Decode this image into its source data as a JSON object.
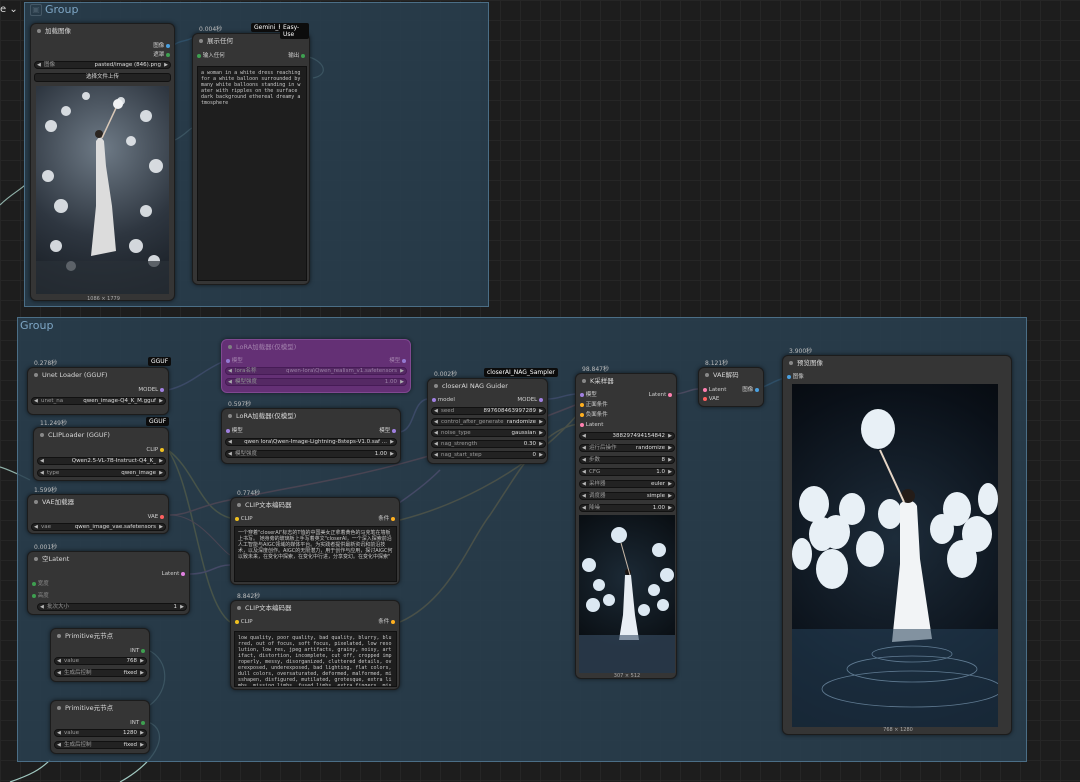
{
  "topbar": {
    "dropdown_label": "e",
    "group_top_title": "Group"
  },
  "group_bottom_title": "Group",
  "nodes": {
    "load_image": {
      "title": "加载图像",
      "out_image": "图像",
      "out_mask": "遮罩",
      "widget_label": "图像",
      "widget_value": "pasted/image (846).png",
      "upload_label": "选择文件上传",
      "dims": "1086 × 1779"
    },
    "show_text": {
      "time": "0.004秒",
      "badge1": "Gemini_Fl",
      "badge2": "Easy-Use",
      "title": "展示任何",
      "in_label": "输入任何",
      "out_label": "输出",
      "text": "a woman in a white dress reaching for a white balloon surrounded by many white balloons standing in water with ripples on the surface dark background ethereal dreamy atmosphere"
    },
    "unet": {
      "time": "0.278秒",
      "badge": "GGUF",
      "title": "Unet Loader (GGUF)",
      "out": "MODEL",
      "w_label": "unet_na",
      "w_value": "qwen_image-Q4_K_M.gguf"
    },
    "lora_bypass": {
      "title": "LoRA加载器(仅模型)",
      "in_label": "模型",
      "out_label": "模型",
      "w1_label": "lora名称",
      "w1_value": "qwen-lora\\Qwen_realism_v1.safetensors",
      "w2_label": "模型强度",
      "w2_value": "1.00"
    },
    "lora": {
      "time": "0.597秒",
      "title": "LoRA加载器(仅模型)",
      "in_label": "模型",
      "out_label": "模型",
      "w1_value": "qwen lora\\Qwen-Image-Lightning-8steps-V1.0.saf ...",
      "w2_label": "模型强度",
      "w2_value": "1.00"
    },
    "clip_loader": {
      "time": "11.249秒",
      "badge": "GGUF",
      "title": "CLIPLoader (GGUF)",
      "out": "CLIP",
      "w1_value": "Qwen2.5-VL-7B-Instruct-Q4_K_",
      "w2_label": "type",
      "w2_value": "qwen_image"
    },
    "vae_loader": {
      "time": "1.599秒",
      "title": "VAE加载器",
      "out": "VAE",
      "w_label": "vae",
      "w_value": "qwen_image_vae.safetensors"
    },
    "empty_latent": {
      "time": "0.001秒",
      "title": "空Latent",
      "out": "Latent",
      "w1_label": "宽度",
      "w2_label": "高度",
      "w3_label": "批次大小",
      "w3_value": "1"
    },
    "prim1": {
      "title": "Primitive元节点",
      "out": "INT",
      "w1_label": "value",
      "w1_value": "768",
      "w2_label": "生成后控制",
      "w2_value": "fixed"
    },
    "prim2": {
      "title": "Primitive元节点",
      "out": "INT",
      "w1_label": "value",
      "w1_value": "1280",
      "w2_label": "生成后控制",
      "w2_value": "fixed"
    },
    "clip_text1": {
      "time": "0.774秒",
      "title": "CLIP文本编码器",
      "in": "CLIP",
      "out": "条件",
      "text": "一个穿着\"closerAI\"标志的T恤的中国美女正拿着黄色的马克笔在墙板上书写。\n\n她身旁的玻璃板上手写着英文\"closerAI，一个深入探索前沿人工智能与AIGC领域的媒体平台。为实践者提供最新资讯和前沿技术，以及深度创作。AIGC的无限潜力，用于创作与应用，探讨AIGC何以致未来，在变化中探索，在变化中行进，分享变幻。在变化中探索\""
    },
    "clip_text2": {
      "time": "8.842秒",
      "title": "CLIP文本编码器",
      "in": "CLIP",
      "out": "条件",
      "text": "low quality, poor quality, bad quality, blurry, blurred, out of focus, soft focus, pixelated, low resolution, low res, jpeg artifacts, grainy, noisy, artifact, distortion, incomplete, cut off, cropped improperly, messy, disorganized, cluttered details, overexposed, underexposed, bad lighting, flat colors, dull colors, oversaturated, deformed, malformed, misshapen, disfigured, mutilated, grotesque, extra limbs, missing limbs, fused limbs, extra fingers, missing fingers, six fingers, too many fingers, malformed hands, unnatural pose, awkward pose, bad anatomy"
    },
    "nag_guider": {
      "time": "0.002秒",
      "badge": "closerAI_NAG_Sampler",
      "title": "closerAI NAG Guider",
      "in_model": "model",
      "out_model": "MODEL",
      "seed_label": "seed",
      "seed_value": "897608463997289",
      "cag_label": "control_after_generate",
      "cag_value": "randomize",
      "nt_label": "noise_type",
      "nt_value": "gaussian",
      "ns_label": "nag_strength",
      "ns_value": "0.30",
      "nst_label": "nag_start_step",
      "nst_value": "0"
    },
    "ksampler": {
      "time": "98.847秒",
      "title": "K采样器",
      "in1": "模型",
      "in2": "正面条件",
      "in3": "负面条件",
      "in4": "Latent",
      "out": "Latent",
      "seed_value": "388297494154842",
      "cag_label": "运行后操作",
      "cag_value": "randomize",
      "steps_label": "步数",
      "steps_value": "8",
      "cfg_label": "CFG",
      "cfg_value": "1.0",
      "sampler_label": "采样器",
      "sampler_value": "euler",
      "sched_label": "调度器",
      "sched_value": "simple",
      "denoise_label": "降噪",
      "denoise_value": "1.00",
      "dims": "307 × 512"
    },
    "vae_decode": {
      "time": "8.121秒",
      "title": "VAE解码",
      "in1": "Latent",
      "in2": "VAE",
      "out": "图像"
    },
    "preview": {
      "time": "3.900秒",
      "title": "预览图像",
      "in": "图像",
      "dims": "768 × 1280"
    }
  }
}
